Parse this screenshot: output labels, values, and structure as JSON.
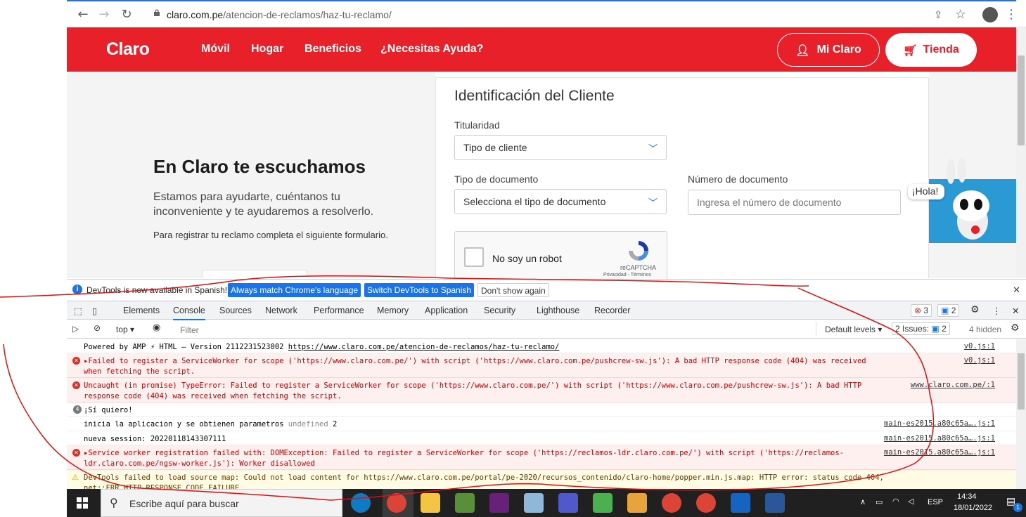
{
  "browser": {
    "url_host": "claro.com.pe",
    "url_path": "/atencion-de-reclamos/haz-tu-reclamo/"
  },
  "header": {
    "logo": "Claro",
    "nav": [
      "Móvil",
      "Hogar",
      "Beneficios",
      "¿Necesitas Ayuda?"
    ],
    "mi_claro": "Mi Claro",
    "tienda": "Tienda",
    "brand_color": "#e8202a"
  },
  "hero": {
    "headline": "En Claro te escuchamos",
    "subtitle": "Estamos para ayudarte, cuéntanos tu inconveniente y te ayudaremos a resolverlo.",
    "note": "Para registrar tu reclamo completa el siguiente formulario."
  },
  "form": {
    "title": "Identificación del Cliente",
    "titularidad_label": "Titularidad",
    "titularidad_value": "Tipo de cliente",
    "tipo_doc_label": "Tipo de documento",
    "tipo_doc_value": "Selecciona el tipo de documento",
    "num_doc_label": "Número de documento",
    "num_doc_placeholder": "Ingresa el número de documento",
    "captcha_text": "No soy un robot",
    "captcha_brand": "reCAPTCHA",
    "captcha_links": "Privacidad - Términos"
  },
  "bot": {
    "greeting": "¡Hola!"
  },
  "devtools": {
    "info_text": "DevTools is now available in Spanish!",
    "btn_match": "Always match Chrome's language",
    "btn_switch": "Switch DevTools to Spanish",
    "btn_dont": "Don't show again",
    "tabs": [
      "Elements",
      "Console",
      "Sources",
      "Network",
      "Performance",
      "Memory",
      "Application",
      "Security",
      "Lighthouse",
      "Recorder"
    ],
    "active_tab": "Console",
    "error_count": "3",
    "message_count": "2",
    "context": "top",
    "filter_placeholder": "Filter",
    "levels": "Default levels",
    "issues_label": "2 Issues:",
    "issues_count": "2",
    "hidden": "4 hidden",
    "logs": [
      {
        "type": "info",
        "text": "Powered by AMP ⚡ HTML – Version 2112231523002 ",
        "link": "https://www.claro.com.pe/atencion-de-reclamos/haz-tu-reclamo/",
        "src": "v0.js:1"
      },
      {
        "type": "error",
        "text": "▸Failed to register a ServiceWorker for scope ('https://www.claro.com.pe/') with script ('https://www.claro.com.pe/pushcrew-sw.js'): A bad HTTP response code (404) was received when fetching the script.",
        "src": "v0.js:1"
      },
      {
        "type": "error",
        "text": "Uncaught (in promise) TypeError: Failed to register a ServiceWorker for scope ('https://www.claro.com.pe/') with script ('https://www.claro.com.pe/pushcrew-sw.js'): A bad HTTP response code (404) was received when fetching the script.",
        "src": "www.claro.com.pe/:1"
      },
      {
        "type": "count",
        "count": "4",
        "text": "¡Sí quiero!"
      },
      {
        "type": "info",
        "text": "inicia la aplicacion y se obtienen parametros ",
        "extra": "undefined",
        "extra2": " 2",
        "src": "main-es2015.a80c65a….js:1"
      },
      {
        "type": "info",
        "text": "nueva session: 20220118143307111",
        "src": "main-es2015.a80c65a….js:1"
      },
      {
        "type": "error",
        "text": "▸Service worker registration failed with: DOMException: Failed to register a ServiceWorker for scope ('https://reclamos-ldr.claro.com.pe/') with script ('https://reclamos-ldr.claro.com.pe/ngsw-worker.js'): Worker disallowed",
        "src": "main-es2015.a80c65a….js:1"
      },
      {
        "type": "warn",
        "text": "DevTools failed to load source map: Could not load content for https://www.claro.com.pe/portal/pe-2020/recursos_contenido/claro-home/popper.min.js.map: HTTP error: status code 404, net::ERR_HTTP_RESPONSE_CODE_FAILURE"
      }
    ]
  },
  "taskbar": {
    "search_placeholder": "Escribe aquí para buscar",
    "language": "ESP",
    "time": "14:34",
    "date": "18/01/2022",
    "notifications": "1"
  }
}
